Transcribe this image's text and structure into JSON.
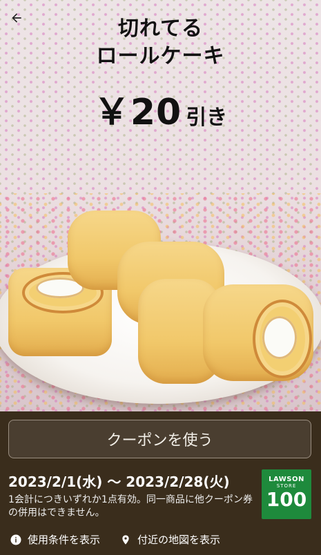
{
  "hero": {
    "title_line1": "切れてる",
    "title_line2": "ロールケーキ",
    "discount_amount": "￥20",
    "discount_suffix": "引き"
  },
  "actions": {
    "use_coupon_label": "クーポンを使う"
  },
  "coupon": {
    "validity": "2023/2/1(水) 〜 2023/2/28(火)",
    "notes": "1会計につきいずれか1点有効。同一商品に他クーポン券の併用はできません。"
  },
  "logo": {
    "line1": "LAWSON",
    "line2": "STORE",
    "line3": "100"
  },
  "links": {
    "terms_label": "使用条件を表示",
    "map_label": "付近の地図を表示"
  },
  "icons": {
    "back": "back-arrow-icon",
    "info": "info-icon",
    "location": "location-pin-icon"
  }
}
